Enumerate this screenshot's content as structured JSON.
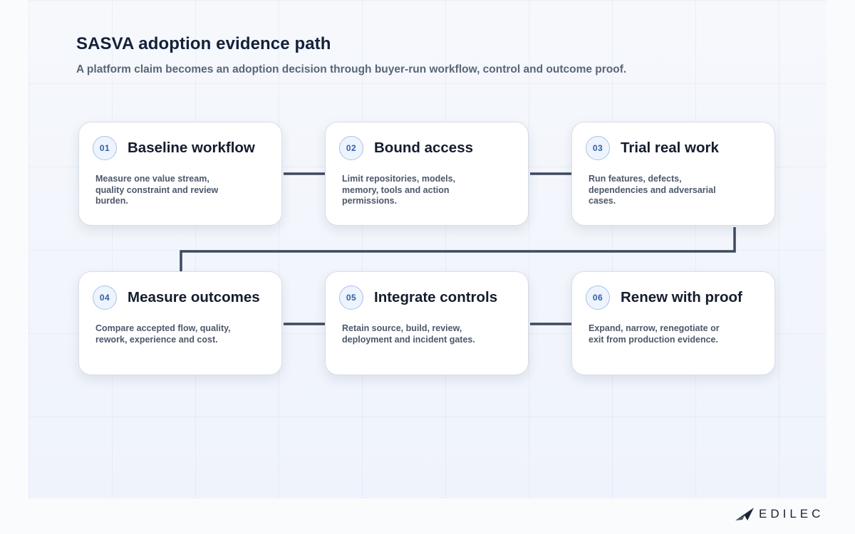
{
  "header": {
    "title": "SASVA adoption evidence path",
    "subtitle": "A platform claim becomes an adoption decision through buyer-run workflow, control and outcome proof."
  },
  "steps": [
    {
      "number": "01",
      "title": "Baseline workflow",
      "description": "Measure one value stream, quality constraint and review burden."
    },
    {
      "number": "02",
      "title": "Bound access",
      "description": "Limit repositories, models, memory, tools and action permissions."
    },
    {
      "number": "03",
      "title": "Trial real work",
      "description": "Run features, defects, dependencies and adversarial cases."
    },
    {
      "number": "04",
      "title": "Measure outcomes",
      "description": "Compare accepted flow, quality, rework, experience and cost."
    },
    {
      "number": "05",
      "title": "Integrate controls",
      "description": "Retain source, build, review, deployment and incident gates."
    },
    {
      "number": "06",
      "title": "Renew with proof",
      "description": "Expand, narrow, renegotiate or exit from production evidence."
    }
  ],
  "brand": {
    "name": "EDILEC",
    "logo_icon": "paper-plane-icon"
  },
  "colors": {
    "connector": "#3e4a5e",
    "badge_text": "#2f5ea8",
    "title": "#14213a"
  }
}
